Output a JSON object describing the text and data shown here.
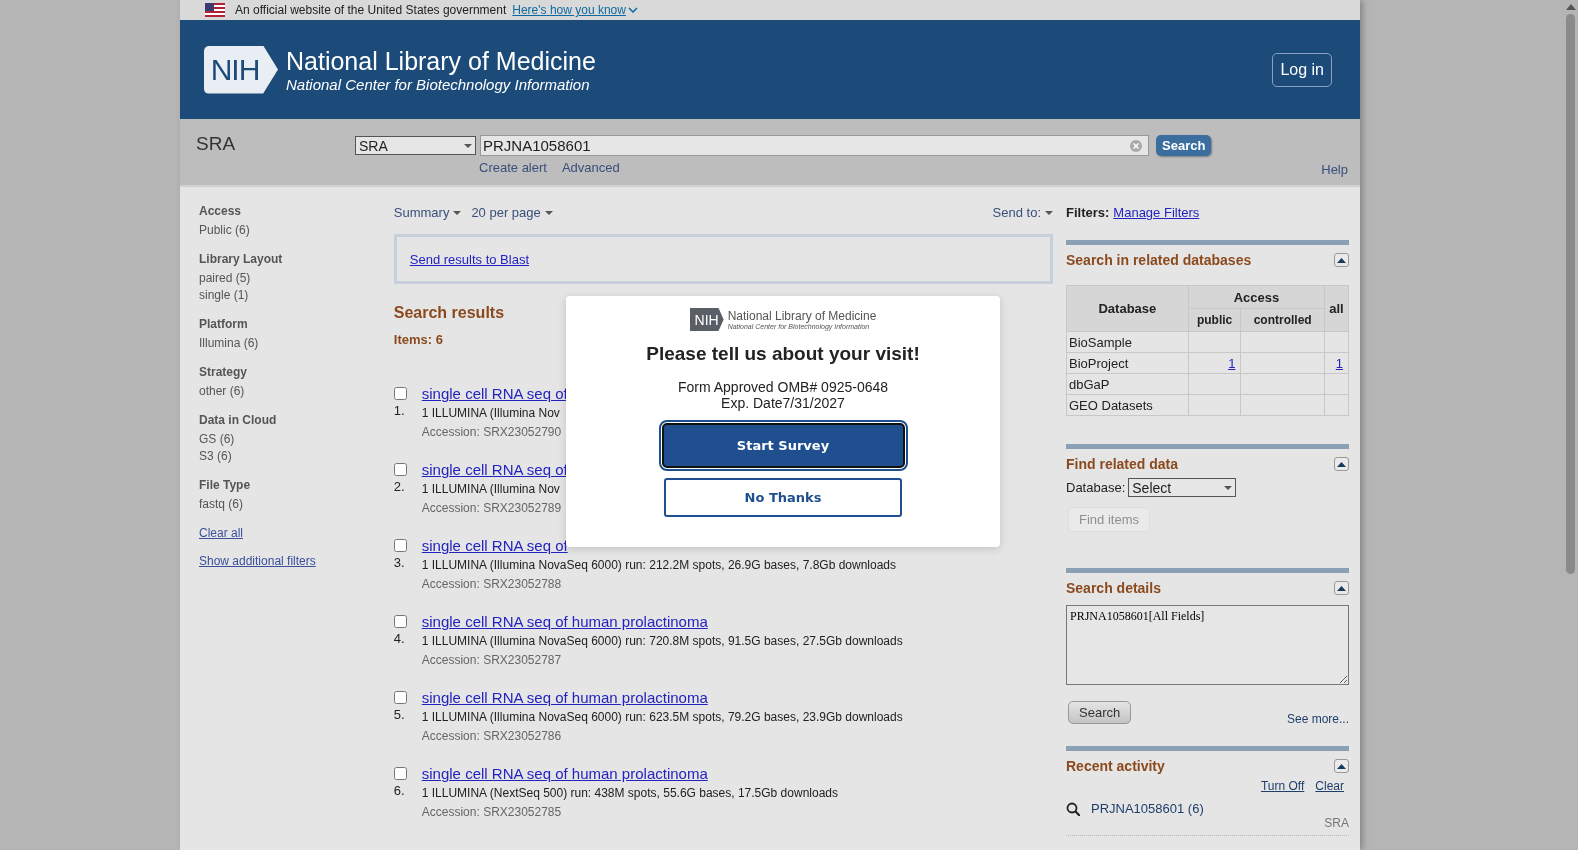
{
  "gov_banner": {
    "text": "An official website of the United States government",
    "link": "Here's how you know"
  },
  "header": {
    "logo": "NIH",
    "title": "National Library of Medicine",
    "subtitle": "National Center for Biotechnology Information",
    "login": "Log in"
  },
  "search_bar": {
    "database_label": "SRA",
    "database": "SRA",
    "query": "PRJNA1058601",
    "button": "Search",
    "links": [
      "Create alert",
      "Advanced"
    ],
    "help": "Help"
  },
  "facets": [
    {
      "title": "Access",
      "items": [
        "Public (6)"
      ]
    },
    {
      "title": "Library Layout",
      "items": [
        "paired (5)",
        "single (1)"
      ]
    },
    {
      "title": "Platform",
      "items": [
        "Illumina (6)"
      ]
    },
    {
      "title": "Strategy",
      "items": [
        "other (6)"
      ]
    },
    {
      "title": "Data in Cloud",
      "items": [
        "GS (6)",
        "S3 (6)"
      ]
    },
    {
      "title": "File Type",
      "items": [
        "fastq (6)"
      ]
    }
  ],
  "facet_links": [
    "Clear all",
    "Show additional filters"
  ],
  "toolbar": {
    "format": "Summary",
    "per_page": "20 per page",
    "send_to": "Send to:"
  },
  "blast_link": "Send results to Blast",
  "results_heading": "Search results",
  "items_count": "Items: 6",
  "results": [
    {
      "number": "1.",
      "checked": false,
      "title": "single cell RNA seq of",
      "details": "1 ILLUMINA (Illumina Nov",
      "accession": "Accession: SRX23052790"
    },
    {
      "number": "2.",
      "checked": false,
      "title": "single cell RNA seq of",
      "details": "1 ILLUMINA (Illumina Nov",
      "accession": "Accession: SRX23052789"
    },
    {
      "number": "3.",
      "checked": false,
      "title": "single cell RNA seq of",
      "details": "1 ILLUMINA (Illumina NovaSeq 6000) run: 212.2M spots, 26.9G bases, 7.8Gb downloads",
      "accession": "Accession: SRX23052788"
    },
    {
      "number": "4.",
      "checked": false,
      "title": "single cell RNA seq of human prolactinoma",
      "details": "1 ILLUMINA (Illumina NovaSeq 6000) run: 720.8M spots, 91.5G bases, 27.5Gb downloads",
      "accession": "Accession: SRX23052787"
    },
    {
      "number": "5.",
      "checked": false,
      "title": "single cell RNA seq of human prolactinoma",
      "details": "1 ILLUMINA (Illumina NovaSeq 6000) run: 623.5M spots, 79.2G bases, 23.9Gb downloads",
      "accession": "Accession: SRX23052786"
    },
    {
      "number": "6.",
      "checked": false,
      "title": "single cell RNA seq of human prolactinoma",
      "details": "1 ILLUMINA (NextSeq 500) run: 438M spots, 55.6G bases, 17.5Gb downloads",
      "accession": "Accession: SRX23052785"
    }
  ],
  "filters": {
    "label": "Filters:",
    "link": "Manage Filters"
  },
  "related_databases": {
    "title": "Search in related databases",
    "columns": {
      "database": "Database",
      "access": "Access",
      "public": "public",
      "controlled": "controlled",
      "all": "all"
    },
    "rows": [
      {
        "database": "BioSample"
      },
      {
        "database": "BioProject",
        "public": "1",
        "all": "1"
      },
      {
        "database": "dbGaP"
      },
      {
        "database": "GEO Datasets"
      }
    ]
  },
  "find_related": {
    "title": "Find related data",
    "label": "Database:",
    "select": "Select",
    "button": "Find items",
    "disabled": true
  },
  "search_details": {
    "title": "Search details",
    "query": "PRJNA1058601[All Fields]",
    "button": "Search",
    "more": "See more..."
  },
  "recent_activity": {
    "title": "Recent activity",
    "links": [
      "Turn Off",
      "Clear"
    ],
    "items": [
      {
        "query": "PRJNA1058601 (6)",
        "database": "SRA"
      }
    ]
  },
  "survey": {
    "logo": "NIH",
    "org": "National Library of Medicine",
    "org_sub": "National Center for Biotechnology Information",
    "heading": "Please tell us about your visit!",
    "lines": [
      "Form Approved OMB# 0925-0648",
      "Exp. Date7/31/2027"
    ],
    "primary": "Start Survey",
    "secondary": "No Thanks"
  }
}
